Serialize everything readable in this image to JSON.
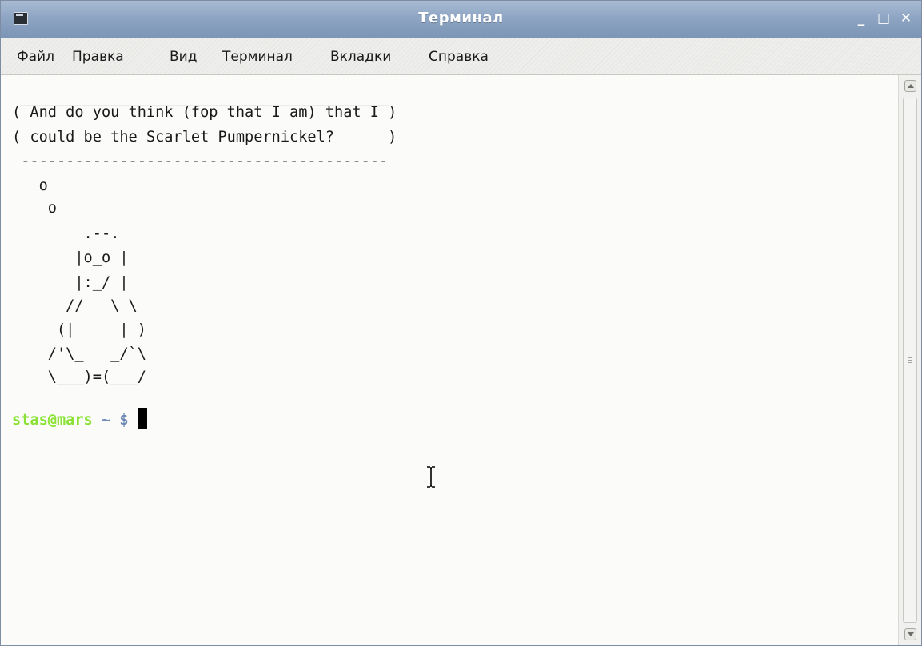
{
  "window": {
    "title": "Терминал",
    "controls": {
      "minimize": "_",
      "maximize": "□",
      "close": "✕"
    },
    "title_icon": "terminal-icon"
  },
  "menu": {
    "items": [
      {
        "accel": "Ф",
        "rest": "айл"
      },
      {
        "accel": "П",
        "rest": "равка"
      },
      {
        "accel": "В",
        "rest": "ид"
      },
      {
        "accel": "Т",
        "rest": "ерминал"
      },
      {
        "pre": "Вкла",
        "accel": "д",
        "rest": "ки"
      },
      {
        "accel": "С",
        "rest": "правка"
      }
    ]
  },
  "terminal": {
    "lines": [
      " _________________________________________",
      "( And do you think (fop that I am) that I )",
      "( could be the Scarlet Pumpernickel?      )",
      " -----------------------------------------",
      "   o",
      "    o",
      "        .--.",
      "       |o_o |",
      "       |:_/ |",
      "      //   \\ \\",
      "     (|     | )",
      "    /'\\_   _/`\\",
      "    \\___)=(___/"
    ],
    "prompt": {
      "user_host": "stas@mars",
      "path": "~ $"
    }
  },
  "colors": {
    "titlebar": "#8ea5c3",
    "prompt_user": "#8ae234",
    "prompt_path": "#6d8ab5",
    "background": "#fbfbf9"
  }
}
